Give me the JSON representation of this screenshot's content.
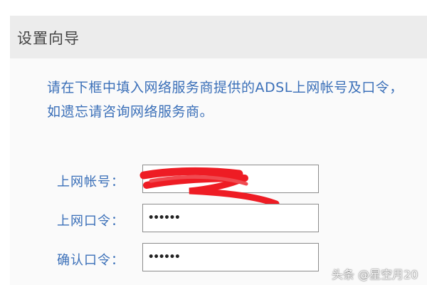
{
  "wizard": {
    "title": "设置向导",
    "instructions": "请在下框中填入网络服务商提供的ADSL上网帐号及口令，如遗忘请咨询网络服务商。"
  },
  "form": {
    "account_label": "上网帐号：",
    "account_value": "",
    "password_label": "上网口令：",
    "password_value": "••••••",
    "confirm_label": "确认口令：",
    "confirm_value": "••••••"
  },
  "watermark": "头条 @星空月20",
  "colors": {
    "label_blue": "#3a6fb8",
    "header_gray": "#ececec",
    "redaction_red": "#ee1c24"
  }
}
